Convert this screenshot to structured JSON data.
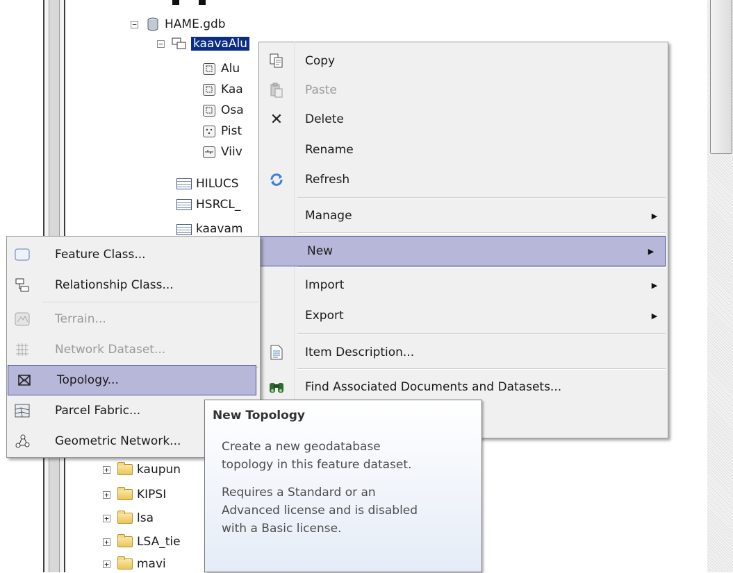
{
  "tree": {
    "gdb_label": "HAME.gdb",
    "dataset_label": "kaavaAlu",
    "children": [
      "Alu",
      "Kaa",
      "Osa",
      "Pist",
      "Viiv"
    ],
    "tables": [
      "HILUCS",
      "HSRCL_",
      "kaavam"
    ],
    "folders": [
      "kaupun",
      "KIPSI",
      "lsa",
      "LSA_tie",
      "mavi"
    ]
  },
  "context_menu": {
    "items": [
      {
        "label": "Copy",
        "icon": "copy-icon"
      },
      {
        "label": "Paste",
        "icon": "paste-icon",
        "disabled": true
      },
      {
        "label": "Delete",
        "icon": "delete-icon"
      },
      {
        "label": "Rename"
      },
      {
        "label": "Refresh",
        "icon": "refresh-icon"
      },
      {
        "label": "Manage",
        "submenu": true
      },
      {
        "label": "New",
        "submenu": true,
        "highlighted": true
      },
      {
        "label": "Import",
        "submenu": true
      },
      {
        "label": "Export",
        "submenu": true
      },
      {
        "label": "Item Description...",
        "icon": "item-description-icon"
      },
      {
        "label": "Find Associated Documents and Datasets...",
        "icon": "binoculars-icon"
      }
    ]
  },
  "new_submenu": {
    "items": [
      {
        "label": "Feature Class...",
        "icon": "feature-class-icon"
      },
      {
        "label": "Relationship Class...",
        "icon": "relationship-class-icon"
      },
      {
        "label": "Terrain...",
        "icon": "terrain-icon",
        "disabled": true
      },
      {
        "label": "Network Dataset...",
        "icon": "network-dataset-icon",
        "disabled": true
      },
      {
        "label": "Topology...",
        "icon": "topology-icon",
        "highlighted": true
      },
      {
        "label": "Parcel Fabric...",
        "icon": "parcel-fabric-icon"
      },
      {
        "label": "Geometric Network...",
        "icon": "geometric-network-icon"
      }
    ]
  },
  "tooltip": {
    "title": "New Topology",
    "body": "Create a new geodatabase\ntopology in this feature dataset.",
    "note": "Requires a Standard or an\nAdvanced license and is disabled\nwith a Basic license."
  },
  "colors": {
    "selection": "#0b2d86",
    "menu_highlight": "#b7b7d9",
    "menu_highlight_border": "#4f4f9c",
    "menu_bg": "#f0f0f0",
    "disabled_text": "#9a9a9a"
  }
}
